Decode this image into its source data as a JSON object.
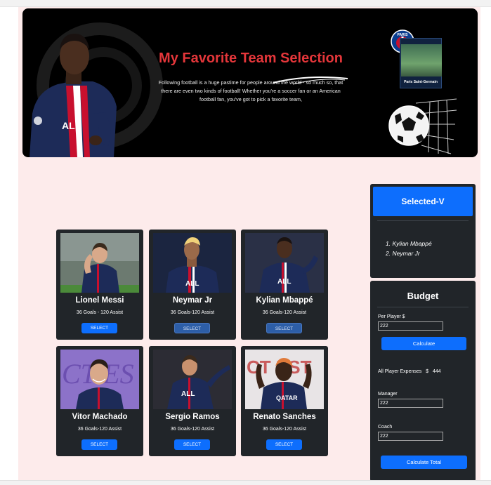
{
  "banner": {
    "title": "My Favorite Team Selection",
    "text": "Following football is a huge pastime for people around the world - so much so, that there are even two kinds of football! Whether you're a soccer fan or an American football fan, you've got to pick a favorite team,",
    "psg_card_label": "Paris Saint-Germain",
    "psg_badge_text": "PARIS"
  },
  "players": [
    {
      "name": "Lionel Messi",
      "stats": "36 Goals - 120 Assist",
      "button": "SELECT",
      "state": "enabled"
    },
    {
      "name": "Neymar Jr",
      "stats": "36 Goals-120 Assist",
      "button": "SELECT",
      "state": "disabled"
    },
    {
      "name": "Kylian Mbappé",
      "stats": "36 Goals-120 Assist",
      "button": "SELECT",
      "state": "disabled"
    },
    {
      "name": "Vitor Machado",
      "stats": "36 Goals-120 Assist",
      "button": "SELECT",
      "state": "enabled"
    },
    {
      "name": "Sergio Ramos",
      "stats": "36 Goals-120 Assist",
      "button": "SELECT",
      "state": "enabled"
    },
    {
      "name": "Renato Sanches",
      "stats": "36 Goals-120 Assist",
      "button": "SELECT",
      "state": "enabled"
    }
  ],
  "selected": {
    "title": "Selected-V",
    "items": [
      "Kylian Mbappé",
      "Neymar Jr"
    ]
  },
  "budget": {
    "title": "Budget",
    "per_player_label": "Per Player $",
    "per_player_value": "222",
    "calculate_label": "Calculate",
    "expenses_label": "All Player Expenses",
    "expenses_currency": "$",
    "expenses_value": "444",
    "manager_label": "Manager",
    "manager_value": "222",
    "coach_label": "Coach",
    "coach_value": "222",
    "calculate_total_label": "Calculate Total"
  },
  "colors": {
    "accent": "#0d6efd",
    "title_red": "#e4363a",
    "card_bg": "#212529",
    "page_bg": "#fdebeb"
  }
}
